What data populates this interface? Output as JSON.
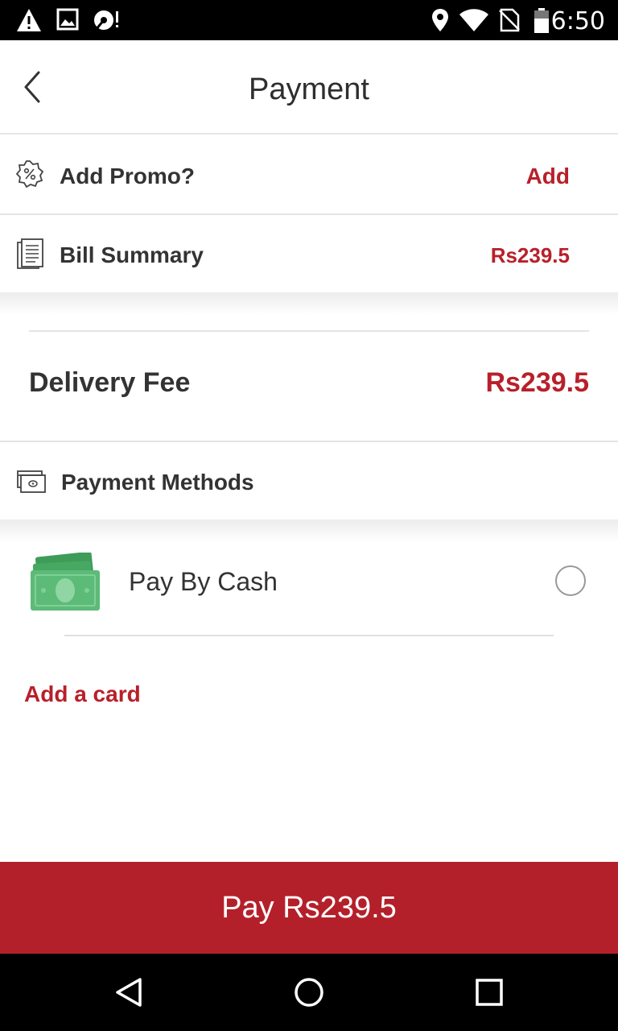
{
  "status_bar": {
    "time": "6:50",
    "left_icons": [
      "warning-icon",
      "image-icon",
      "debug-icon"
    ],
    "right_icons": [
      "location-icon",
      "wifi-icon",
      "no-sim-icon",
      "battery-icon"
    ]
  },
  "header": {
    "title": "Payment",
    "back_icon": "chevron-left-icon"
  },
  "promo": {
    "label": "Add Promo?",
    "action": "Add",
    "icon": "promo-badge-icon"
  },
  "bill": {
    "label": "Bill Summary",
    "amount": "Rs239.5",
    "icon": "receipt-icon"
  },
  "delivery": {
    "label": "Delivery Fee",
    "amount": "Rs239.5"
  },
  "payment_methods": {
    "label": "Payment Methods",
    "icon": "payment-card-icon",
    "options": [
      {
        "label": "Pay By Cash",
        "icon": "cash-icon",
        "selected": false
      }
    ],
    "add_card": "Add a card"
  },
  "pay_button": {
    "label": "Pay Rs239.5"
  },
  "nav_bar": {
    "icons": [
      "back-triangle-icon",
      "home-circle-icon",
      "recents-square-icon"
    ]
  },
  "colors": {
    "accent": "#b8202a",
    "pay_button": "#b4202a",
    "cash_green": "#3fa35c"
  }
}
